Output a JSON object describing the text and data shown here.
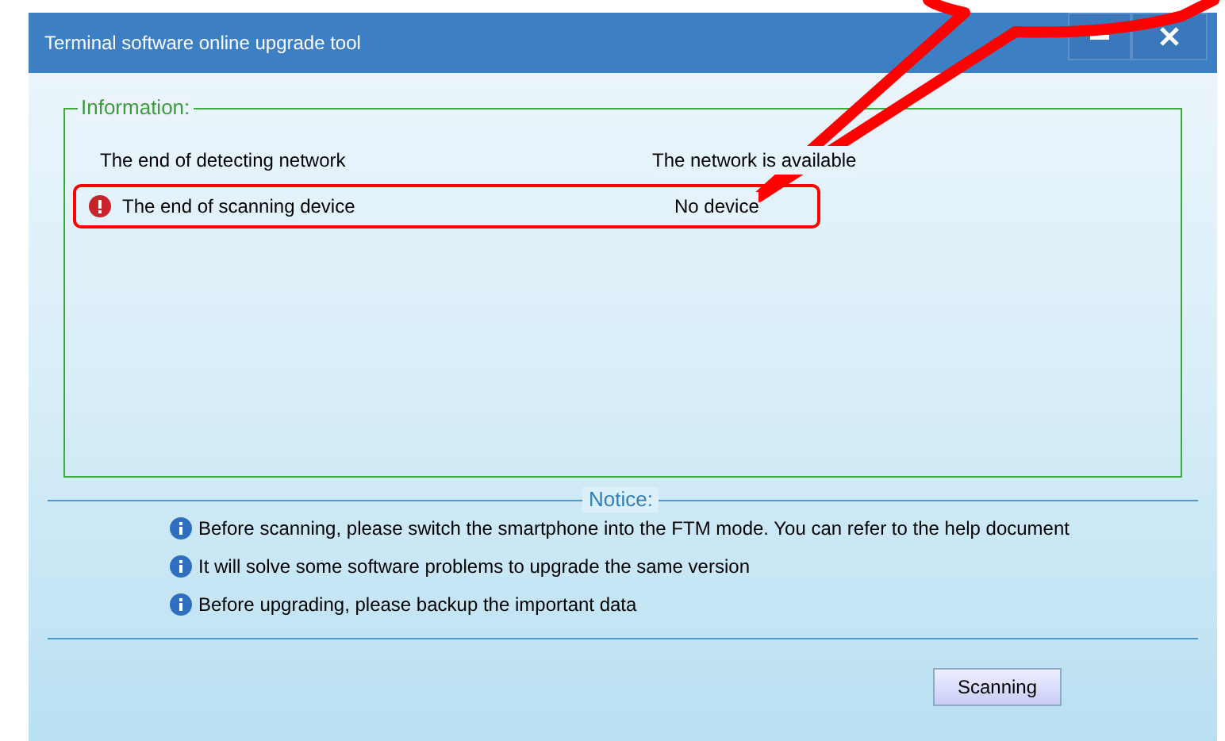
{
  "window": {
    "title": "Terminal software online upgrade tool"
  },
  "information": {
    "title": "Information:",
    "rows": [
      {
        "kind": "ok",
        "label": "The end of detecting network",
        "status": "The network is available",
        "highlighted": false
      },
      {
        "kind": "error",
        "label": "The end of scanning device",
        "status": "No device",
        "highlighted": true
      }
    ]
  },
  "notice": {
    "title": "Notice:",
    "items": [
      "Before scanning, please switch the smartphone into the FTM mode. You can refer to the help document",
      "It will solve some software problems to upgrade the same version",
      "Before upgrading, please backup the important data"
    ]
  },
  "buttons": [
    {
      "label": "Scanning"
    }
  ]
}
